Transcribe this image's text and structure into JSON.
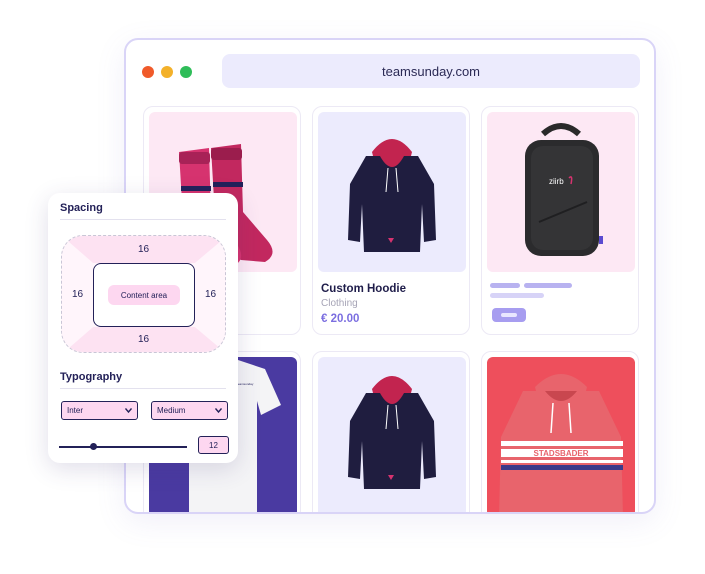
{
  "browser": {
    "url": "teamsunday.com",
    "window_controls": [
      "close-dot",
      "minimize-dot",
      "maximize-dot"
    ]
  },
  "products": [
    {
      "image": "pink-socks",
      "title": "",
      "category": "",
      "price": ""
    },
    {
      "image": "navy-hoodie",
      "title": "Custom Hoodie",
      "category": "Clothing",
      "price": "€ 20.00"
    },
    {
      "image": "black-backpack",
      "title": "",
      "category": "",
      "price": "",
      "placeholder": true
    },
    {
      "image": "white-tshirt",
      "title": "",
      "category": "",
      "price": ""
    },
    {
      "image": "navy-hoodie",
      "title": "",
      "category": "",
      "price": ""
    },
    {
      "image": "red-hoodie",
      "title": "",
      "category": "",
      "price": "",
      "print_text": "STADSBADER"
    }
  ],
  "panel": {
    "spacing": {
      "title": "Spacing",
      "top": "16",
      "left": "16",
      "right": "16",
      "bottom": "16",
      "content_label": "Content area"
    },
    "typography": {
      "title": "Typography",
      "font_family": "Inter",
      "font_weight": "Medium",
      "font_size": "12",
      "slider_level": 0.27
    }
  },
  "colors": {
    "accent": "#7b6ee0",
    "navy": "#232158",
    "pink_fill": "#fdd7f0",
    "window_border": "#d9d4f7"
  }
}
